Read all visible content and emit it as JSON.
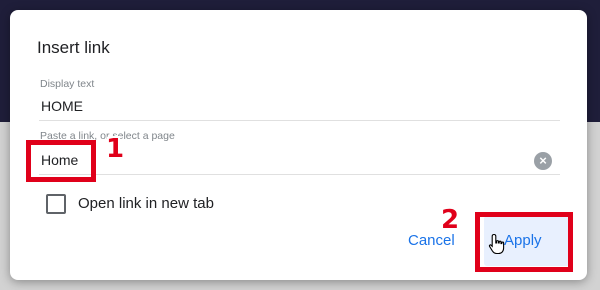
{
  "dialog": {
    "title": "Insert link",
    "display_text": {
      "label": "Display text",
      "value": "HOME"
    },
    "link": {
      "label": "Paste a link, or select a page",
      "value": "Home",
      "clear_icon": "close-circle-icon"
    },
    "new_tab": {
      "label": "Open link in new tab",
      "checked": false
    },
    "cancel_label": "Cancel",
    "apply_label": "Apply"
  },
  "annotations": {
    "step1": "1",
    "step2": "2"
  },
  "colors": {
    "accent": "#1a73e8",
    "highlight": "#e0001a",
    "backdrop_top": "#1f1e3a"
  }
}
